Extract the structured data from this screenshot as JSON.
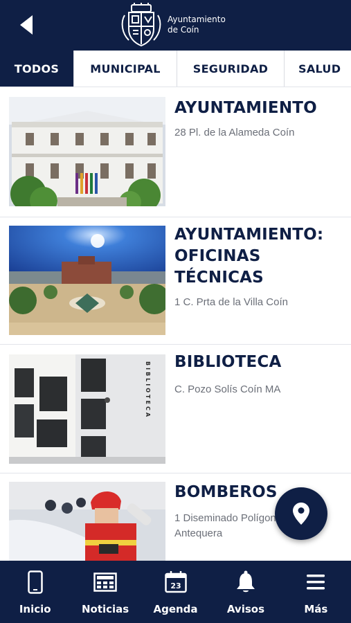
{
  "header": {
    "logo_line1": "Ayuntamiento",
    "logo_line2": "de Coín"
  },
  "tabs": [
    {
      "label": "TODOS",
      "active": true
    },
    {
      "label": "MUNICIPAL",
      "active": false
    },
    {
      "label": "SEGURIDAD",
      "active": false
    },
    {
      "label": "SALUD",
      "active": false
    }
  ],
  "places": [
    {
      "title": "AYUNTAMIENTO",
      "address": "28 Pl. de la Alameda Coín"
    },
    {
      "title": "AYUNTAMIENTO: OFICINAS TÉCNICAS",
      "address": "1 C. Prta de la Villa Coín"
    },
    {
      "title": "BIBLIOTECA",
      "address": "C. Pozo Solís Coín MA",
      "sign": "BIBLIOTECA"
    },
    {
      "title": "BOMBEROS",
      "address": "1 Diseminado Polígono Antequera"
    }
  ],
  "bottom_nav": [
    {
      "label": "Inicio",
      "icon": "phone-icon"
    },
    {
      "label": "Noticias",
      "icon": "newspaper-icon"
    },
    {
      "label": "Agenda",
      "icon": "calendar-icon",
      "day": "23"
    },
    {
      "label": "Avisos",
      "icon": "bell-icon"
    },
    {
      "label": "Más",
      "icon": "menu-icon"
    }
  ],
  "colors": {
    "primary": "#0f1f45",
    "text_secondary": "#6b6f78",
    "divider": "#e2e4ea"
  }
}
